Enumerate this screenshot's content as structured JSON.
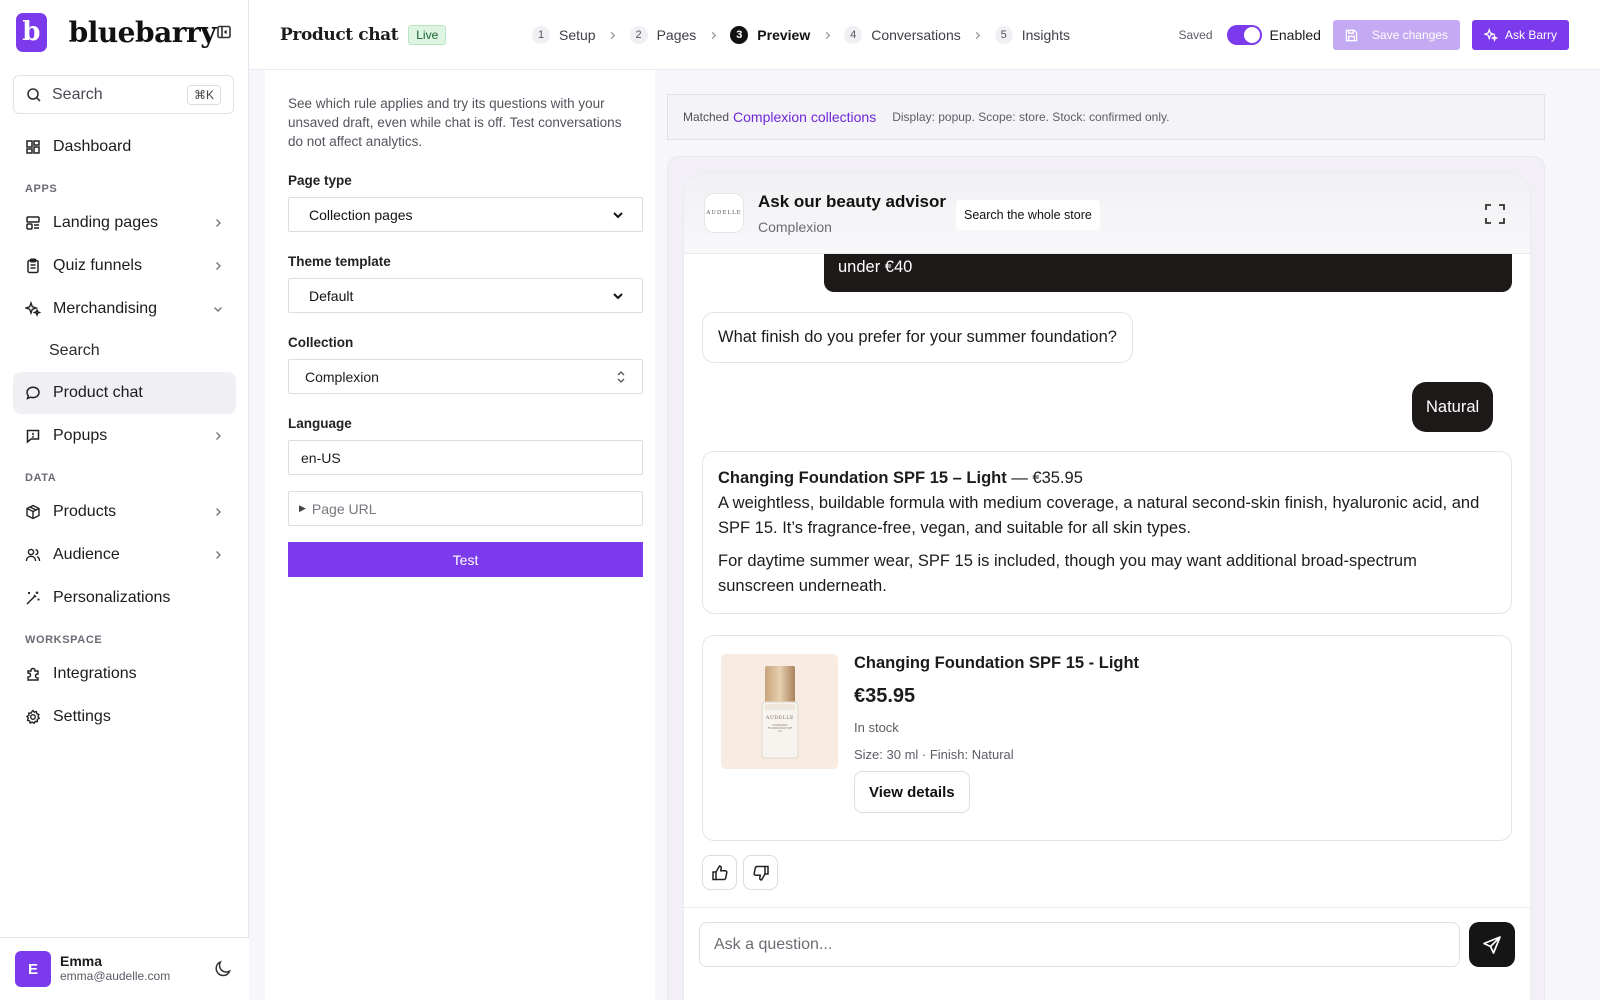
{
  "brand": {
    "logo_letter": "b",
    "name": "bluebarry"
  },
  "sidebar": {
    "search_placeholder": "Search",
    "search_shortcut": "⌘K",
    "dashboard": "Dashboard",
    "section_apps": "APPS",
    "landing_pages": "Landing pages",
    "quiz_funnels": "Quiz funnels",
    "merchandising": "Merchandising",
    "merch_search": "Search",
    "product_chat": "Product chat",
    "popups": "Popups",
    "section_data": "DATA",
    "products": "Products",
    "audience": "Audience",
    "personalizations": "Personalizations",
    "section_workspace": "WORKSPACE",
    "integrations": "Integrations",
    "settings": "Settings"
  },
  "user": {
    "initial": "E",
    "name": "Emma",
    "email": "emma@audelle.com"
  },
  "header": {
    "title": "Product chat",
    "status": "Live",
    "steps": [
      {
        "num": "1",
        "label": "Setup"
      },
      {
        "num": "2",
        "label": "Pages"
      },
      {
        "num": "3",
        "label": "Preview"
      },
      {
        "num": "4",
        "label": "Conversations"
      },
      {
        "num": "5",
        "label": "Insights"
      }
    ],
    "saved": "Saved",
    "enabled_label": "Enabled",
    "save_button": "Save changes",
    "ask_button": "Ask Barry"
  },
  "form": {
    "help": "See which rule applies and try its questions with your unsaved draft, even while chat is off. Test conversations do not affect analytics.",
    "page_type_label": "Page type",
    "page_type_value": "Collection pages",
    "theme_label": "Theme template",
    "theme_value": "Default",
    "collection_label": "Collection",
    "collection_value": "Complexion",
    "language_label": "Language",
    "language_value": "en-US",
    "page_url_label": "Page URL",
    "test_button": "Test"
  },
  "match": {
    "prefix": "Matched",
    "rule": "Complexion collections",
    "meta": "Display: popup. Scope: store. Stock: confirmed only."
  },
  "widget": {
    "logo_text": "AUDELLE",
    "title": "Ask our beauty advisor",
    "subtitle": "Complexion",
    "search_store": "Search the whole store",
    "messages": {
      "user_1": "under €40",
      "bot_question": "What finish do you prefer for your summer foundation?",
      "user_2": "Natural",
      "answer_product": "Changing Foundation SPF 15 – Light",
      "answer_price": " — €35.95",
      "answer_p1": "A weightless, buildable formula with medium coverage, a natural second-skin finish, hyaluronic acid, and SPF 15. It’s fragrance-free, vegan, and suitable for all skin types.",
      "answer_p2": "For daytime summer wear, SPF 15 is included, though you may want additional broad-spectrum sunscreen underneath."
    },
    "product": {
      "name": "Changing Foundation SPF 15 - Light",
      "price": "€35.95",
      "stock": "In stock",
      "attrs": "Size: 30 ml · Finish: Natural",
      "button": "View details",
      "bottle_brand": "AUDELLE",
      "bottle_label": "CHANGING FOUNDATION SPF 15"
    },
    "composer_placeholder": "Ask a question..."
  }
}
